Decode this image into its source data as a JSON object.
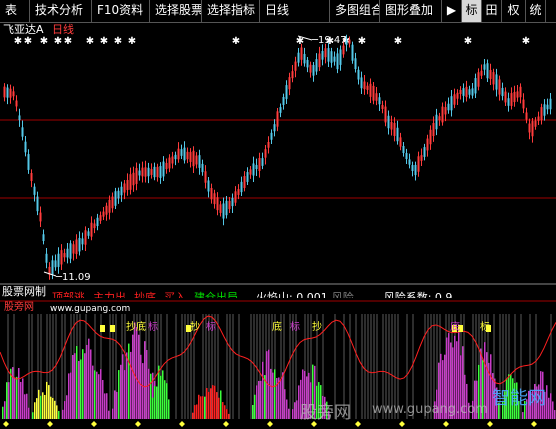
{
  "toolbar": {
    "tabs": [
      {
        "label": "表",
        "selected": false
      },
      {
        "label": "技术分析",
        "selected": false
      },
      {
        "label": "F10资料",
        "selected": false
      },
      {
        "label": "选择股票",
        "selected": false
      },
      {
        "label": "选择指标",
        "selected": false
      },
      {
        "label": "日线",
        "selected": false
      },
      {
        "label": "多图组合",
        "selected": false
      },
      {
        "label": "图形叠加",
        "selected": false
      },
      {
        "label": "▶",
        "selected": false
      },
      {
        "label": "标",
        "selected": true
      },
      {
        "label": "田",
        "selected": false
      },
      {
        "label": "权",
        "selected": false
      },
      {
        "label": "统",
        "selected": false
      }
    ]
  },
  "main_chart": {
    "stock_name": "飞亚达A",
    "period": "日线",
    "high_label": "19.47",
    "low_label": "11.09"
  },
  "indicator_panel": {
    "name": "股票网制",
    "legend": [
      {
        "text": "顶部逃",
        "color": "#ff2020"
      },
      {
        "text": "主力出",
        "color": "#ff2020"
      },
      {
        "text": "抄底",
        "color": "#ff2020"
      },
      {
        "text": "买入",
        "color": "#ff2020"
      },
      {
        "text": "建仓出局",
        "color": "#00e000"
      },
      {
        "text": "火焰山: 0.001",
        "color": "#ffffff"
      },
      {
        "text": "风险",
        "color": "#808080"
      },
      {
        "text": "风险系数: 0.9",
        "color": "#ffffff"
      }
    ],
    "site_label": "股旁网",
    "site_url": "www.gupang.com",
    "signals": [
      "抄底",
      "标",
      "抄",
      "标",
      "底",
      "标",
      "抄",
      "底",
      "标"
    ]
  },
  "watermarks": {
    "cn": "股旁网",
    "url": "www.gupang.com",
    "brand": "智能网"
  },
  "colors": {
    "up": "#ff3c3c",
    "down": "#54c8e8",
    "grid": "#a00000",
    "histogram_purple": "#c83cc8",
    "histogram_green": "#3cff3c",
    "histogram_yellow": "#ffff3c",
    "histogram_red": "#ff2020"
  }
}
